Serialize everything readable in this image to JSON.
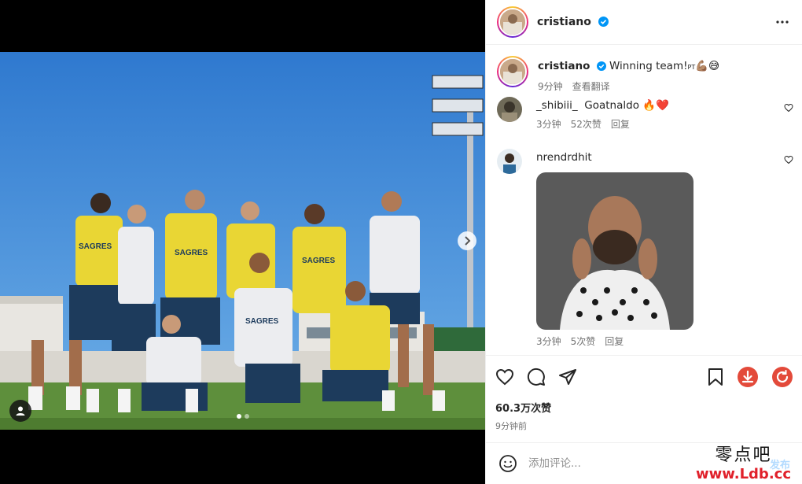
{
  "post": {
    "username": "cristiano",
    "caption_text": "Winning team!",
    "caption_flag": "PT",
    "caption_emoji": "💪🏽😅",
    "caption_time": "9分钟",
    "translate_label": "查看翻译",
    "likes": "60.3万次赞",
    "posted_ago": "9分钟前"
  },
  "photo": {
    "jersey_text": "SAGRES"
  },
  "comments": [
    {
      "username": "_shibiii_",
      "text": "Goatnaldo 🔥❤️",
      "time": "3分钟",
      "likes": "52次赞",
      "reply": "回复"
    },
    {
      "username": "nrendrdhit",
      "text": "",
      "time": "3分钟",
      "likes": "5次赞",
      "reply": "回复"
    }
  ],
  "add_comment": {
    "placeholder": "添加评论...",
    "post_label": "发布"
  },
  "watermark": {
    "top": "零点吧",
    "bottom": "www.Ldb.cc"
  },
  "colors": {
    "verified": "#0095f6",
    "download": "#e34a3a",
    "refresh": "#e34a3a"
  },
  "icons": [
    "more-icon",
    "verified-icon",
    "heart-icon",
    "comment-icon",
    "share-icon",
    "bookmark-icon",
    "download-icon",
    "refresh-icon",
    "emoji-icon",
    "chevron-right-icon",
    "user-tag-icon"
  ]
}
